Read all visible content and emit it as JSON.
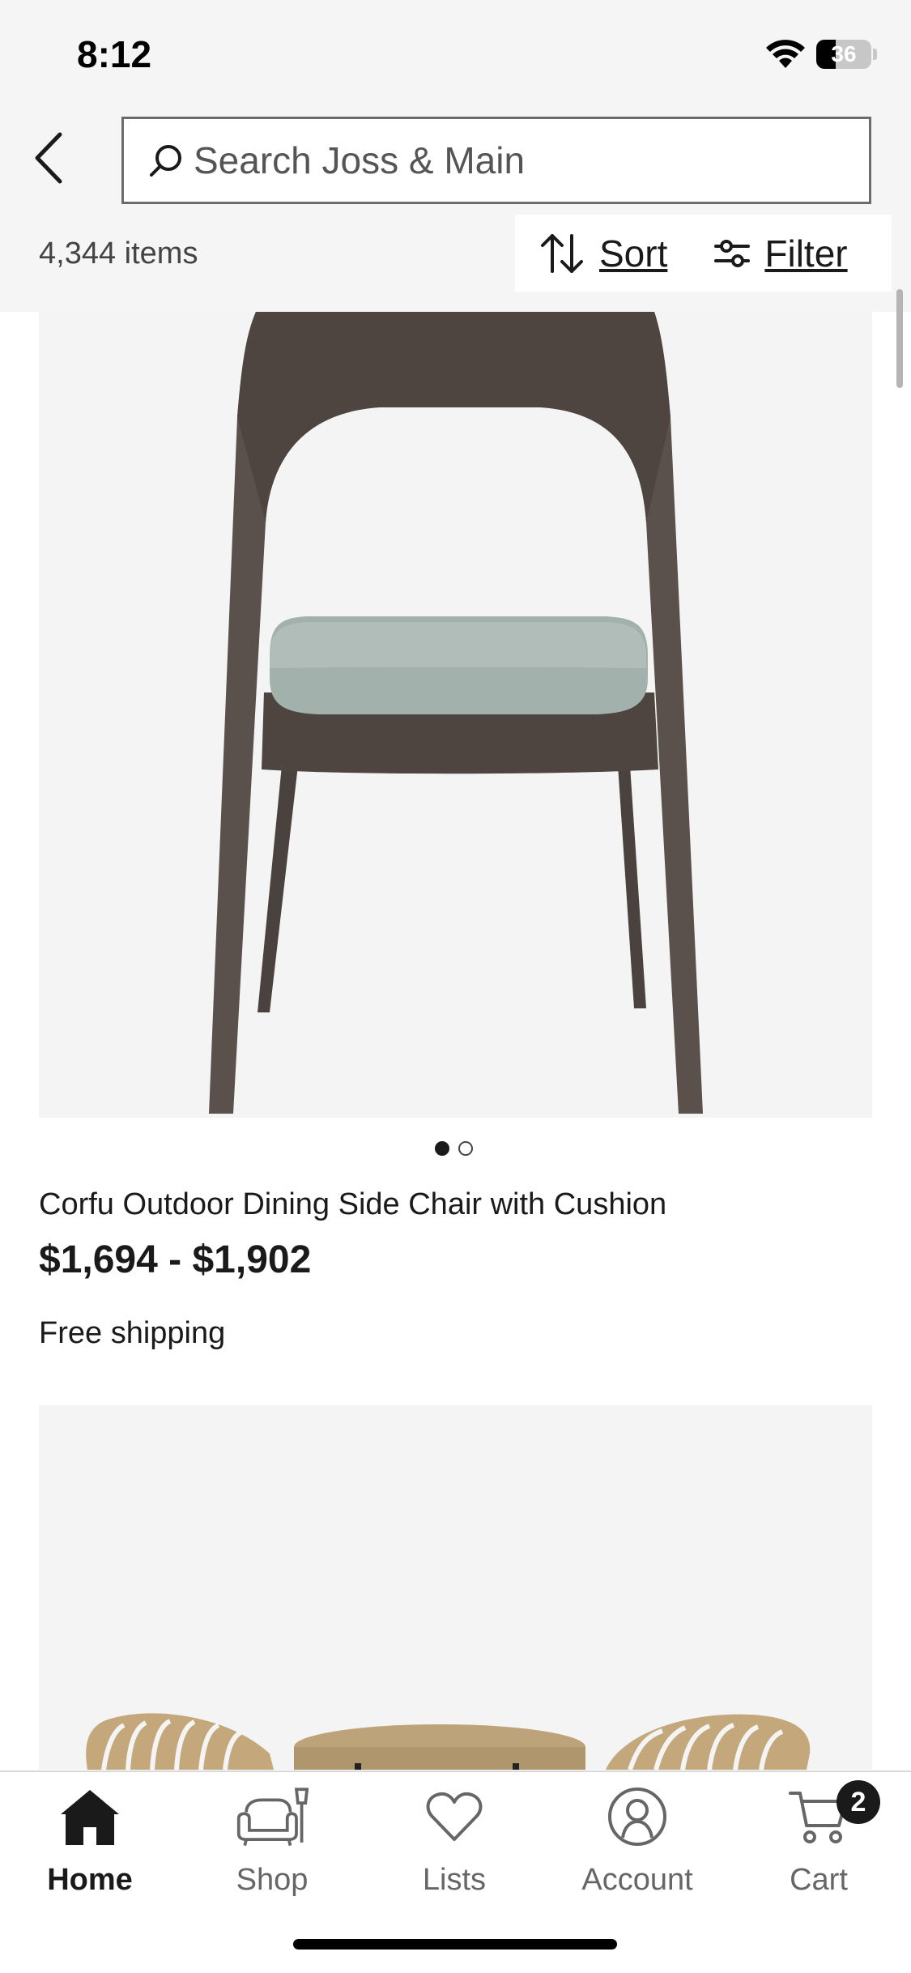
{
  "status_bar": {
    "time": "8:12",
    "battery": "36",
    "battery_level": 0.36
  },
  "header": {
    "search_placeholder": "Search Joss & Main",
    "items_count": "4,344 items",
    "sort_label": "Sort",
    "filter_label": "Filter"
  },
  "products": [
    {
      "title": "Corfu Outdoor Dining Side Chair with Cushion",
      "price": "$1,694 - $1,902",
      "shipping": "Free shipping",
      "image_dots": {
        "count": 2,
        "active": 0
      }
    }
  ],
  "bottom_nav": {
    "items": [
      {
        "label": "Home",
        "icon": "home-icon",
        "active": true
      },
      {
        "label": "Shop",
        "icon": "shop-icon",
        "active": false
      },
      {
        "label": "Lists",
        "icon": "heart-icon",
        "active": false
      },
      {
        "label": "Account",
        "icon": "account-icon",
        "active": false
      },
      {
        "label": "Cart",
        "icon": "cart-icon",
        "active": false
      }
    ],
    "cart_badge": "2"
  }
}
